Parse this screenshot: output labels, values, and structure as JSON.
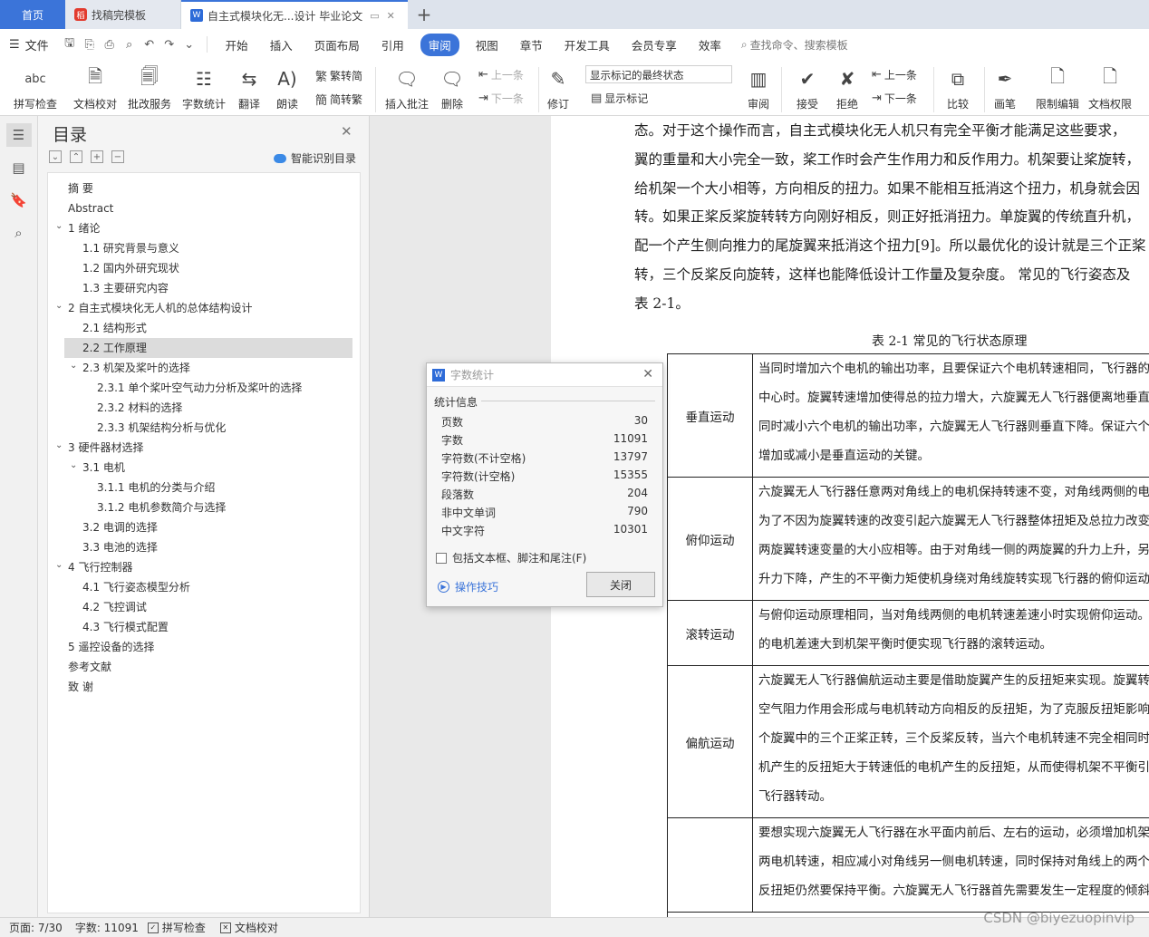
{
  "tabs": {
    "home": "首页",
    "template": "找稿完模板",
    "document": "自主式模块化无...设计 毕业论文",
    "add": "+"
  },
  "menu": {
    "file": "文件",
    "items": [
      "开始",
      "插入",
      "页面布局",
      "引用",
      "审阅",
      "视图",
      "章节",
      "开发工具",
      "会员专享",
      "效率"
    ],
    "active": "审阅",
    "search": "查找命令、搜索模板"
  },
  "ribbon": {
    "spell": "拼写检查",
    "proofread": "文档校对",
    "annotate_service": "批改服务",
    "word_count": "字数统计",
    "translate": "翻译",
    "read_aloud": "朗读",
    "to_traditional": "繁转简",
    "to_simplified": "简转繁",
    "insert_comment": "插入批注",
    "delete": "删除",
    "prev": "上一条",
    "next": "下一条",
    "revise": "修订",
    "markup_state": "显示标记的最终状态",
    "show_markup": "显示标记",
    "review": "审阅",
    "accept": "接受",
    "reject": "拒绝",
    "prev2": "上一条",
    "next2": "下一条",
    "compare": "比较",
    "pen": "画笔",
    "restrict": "限制编辑",
    "permission": "文档权限",
    "abc": "abc"
  },
  "toc": {
    "title": "目录",
    "smart": "智能识别目录",
    "items": [
      {
        "label": "摘 要",
        "level": 1
      },
      {
        "label": "Abstract",
        "level": 1
      },
      {
        "label": "1 绪论",
        "level": 1
      },
      {
        "label": "1.1 研究背景与意义",
        "level": 2
      },
      {
        "label": "1.2 国内外研究现状",
        "level": 2
      },
      {
        "label": "1.3 主要研究内容",
        "level": 2
      },
      {
        "label": "2 自主式模块化无人机的总体结构设计",
        "level": 1
      },
      {
        "label": "2.1 结构形式",
        "level": 2
      },
      {
        "label": "2.2 工作原理",
        "level": 2
      },
      {
        "label": "2.3 机架及桨叶的选择",
        "level": 2
      },
      {
        "label": "2.3.1 单个桨叶空气动力分析及桨叶的选择",
        "level": 3
      },
      {
        "label": "2.3.2 材料的选择",
        "level": 3
      },
      {
        "label": "2.3.3 机架结构分析与优化",
        "level": 3
      },
      {
        "label": "3 硬件器材选择",
        "level": 1
      },
      {
        "label": "3.1 电机",
        "level": 2
      },
      {
        "label": "3.1.1 电机的分类与介绍",
        "level": 3
      },
      {
        "label": "3.1.2 电机参数简介与选择",
        "level": 3
      },
      {
        "label": "3.2 电调的选择",
        "level": 2
      },
      {
        "label": "3.3 电池的选择",
        "level": 2
      },
      {
        "label": "4 飞行控制器",
        "level": 1
      },
      {
        "label": "4.1 飞行姿态模型分析",
        "level": 2
      },
      {
        "label": "4.2 飞控调试",
        "level": 2
      },
      {
        "label": "4.3 飞行模式配置",
        "level": 2
      },
      {
        "label": "5 遥控设备的选择",
        "level": 1
      },
      {
        "label": "参考文献",
        "level": 1
      },
      {
        "label": "致 谢",
        "level": 1
      }
    ]
  },
  "document": {
    "paragraph": [
      "态。对于这个操作而言，自主式模块化无人机只有完全平衡才能满足这些要求，",
      "翼的重量和大小完全一致，桨工作时会产生作用力和反作用力。机架要让桨旋转，",
      "给机架一个大小相等，方向相反的扭力。如果不能相互抵消这个扭力，机身就会因",
      "转。如果正桨反桨旋转转方向刚好相反，则正好抵消扭力。单旋翼的传统直升机，",
      "配一个产生侧向推力的尾旋翼来抵消这个扭力[9]。所以最优化的设计就是三个正桨",
      "转，三个反桨反向旋转，这样也能降低设计工作量及复杂度。 常见的飞行姿态及",
      "表 2-1。"
    ],
    "table_caption": "表 2-1 常见的飞行状态原理",
    "table": [
      {
        "label": "垂直运动",
        "lines": [
          "当同时增加六个电机的输出功率，且要保证六个电机转速相同，飞行器的重",
          "中心时。旋翼转速增加使得总的拉力增大，六旋翼无人飞行器便离地垂直",
          "同时减小六个电机的输出功率，六旋翼无人飞行器则垂直下降。保证六个",
          "增加或减小是垂直运动的关键。"
        ]
      },
      {
        "label": "俯仰运动",
        "lines": [
          "六旋翼无人飞行器任意两对角线上的电机保持转速不变，对角线两侧的电",
          "为了不因为旋翼转速的改变引起六旋翼无人飞行器整体扭矩及总拉力改变",
          "两旋翼转速变量的大小应相等。由于对角线一侧的两旋翼的升力上升，另一",
          "升力下降，产生的不平衡力矩使机身绕对角线旋转实现飞行器的俯仰运动"
        ]
      },
      {
        "label": "滚转运动",
        "lines": [
          "与俯仰运动原理相同，当对角线两侧的电机转速差速小时实现俯仰运动。当",
          "的电机差速大到机架平衡时便实现飞行器的滚转运动。"
        ]
      },
      {
        "label": "偏航运动",
        "lines": [
          "六旋翼无人飞行器偏航运动主要是借助旋翼产生的反扭矩来实现。旋翼转动",
          "空气阻力作用会形成与电机转动方向相反的反扭矩，为了克服反扭矩影响",
          "个旋翼中的三个正桨正转，三个反桨反转，当六个电机转速不完全相同时，",
          "机产生的反扭矩大于转速低的电机产生的反扭矩，从而使得机架不平衡引起",
          "飞行器转动。"
        ]
      },
      {
        "label": "",
        "lines": [
          "要想实现六旋翼无人飞行器在水平面内前后、左右的运动，必须增加机架对",
          "两电机转速，相应减小对角线另一侧电机转速，同时保持对角线上的两个电",
          "反扭矩仍然要保持平衡。六旋翼无人飞行器首先需要发生一定程度的倾斜"
        ]
      }
    ]
  },
  "dialog": {
    "title": "字数统计",
    "section": "统计信息",
    "stats": [
      {
        "label": "页数",
        "value": "30"
      },
      {
        "label": "字数",
        "value": "11091"
      },
      {
        "label": "字符数(不计空格)",
        "value": "13797"
      },
      {
        "label": "字符数(计空格)",
        "value": "15355"
      },
      {
        "label": "段落数",
        "value": "204"
      },
      {
        "label": "非中文单词",
        "value": "790"
      },
      {
        "label": "中文字符",
        "value": "10301"
      }
    ],
    "checkbox": "包括文本框、脚注和尾注(F)",
    "tips": "操作技巧",
    "close": "关闭"
  },
  "status": {
    "page": "页面: 7/30",
    "words": "字数: 11091",
    "spell": "拼写检查",
    "proof": "文档校对"
  },
  "watermark": "CSDN @biyezuopinvip"
}
